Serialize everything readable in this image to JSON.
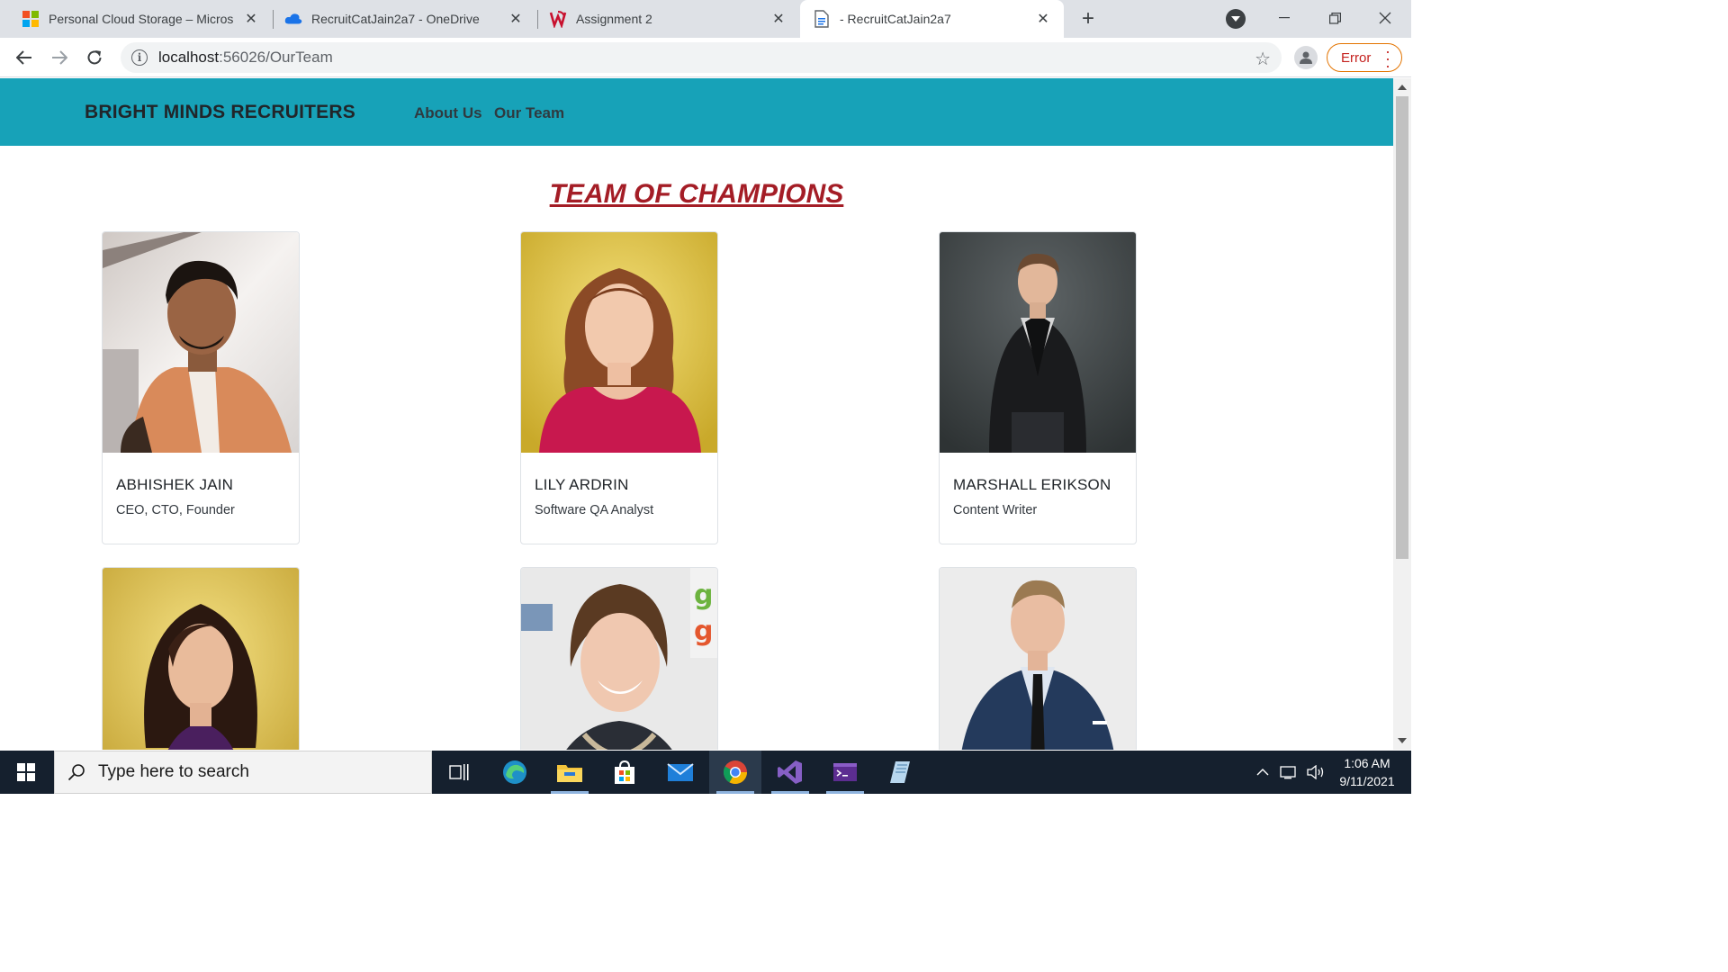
{
  "browser": {
    "tabs": [
      {
        "title": "Personal Cloud Storage – Micros",
        "icon": "microsoft-logo-icon"
      },
      {
        "title": "RecruitCatJain2a7 - OneDrive",
        "icon": "onedrive-cloud-icon"
      },
      {
        "title": "Assignment 2",
        "icon": "university-logo-icon"
      },
      {
        "title": "- RecruitCatJain2a7",
        "icon": "document-icon",
        "active": true
      }
    ],
    "url_host": "localhost",
    "url_path": ":56026/OurTeam",
    "error_label": "Error"
  },
  "site": {
    "brand": "BRIGHT MINDS RECRUITERS",
    "nav": [
      "About Us",
      "Our Team"
    ],
    "heading": "TEAM OF CHAMPIONS",
    "heading_color": "#a41d26",
    "header_color": "#17a2b8",
    "members": [
      {
        "name": "ABHISHEK JAIN",
        "role": "CEO, CTO, Founder"
      },
      {
        "name": "LILY ARDRIN",
        "role": "Software QA Analyst"
      },
      {
        "name": "MARSHALL ERIKSON",
        "role": "Content Writer"
      },
      {
        "name": "",
        "role": ""
      },
      {
        "name": "",
        "role": ""
      },
      {
        "name": "",
        "role": ""
      }
    ]
  },
  "taskbar": {
    "search_placeholder": "Type here to search",
    "time": "1:06 AM",
    "date": "9/11/2021"
  }
}
